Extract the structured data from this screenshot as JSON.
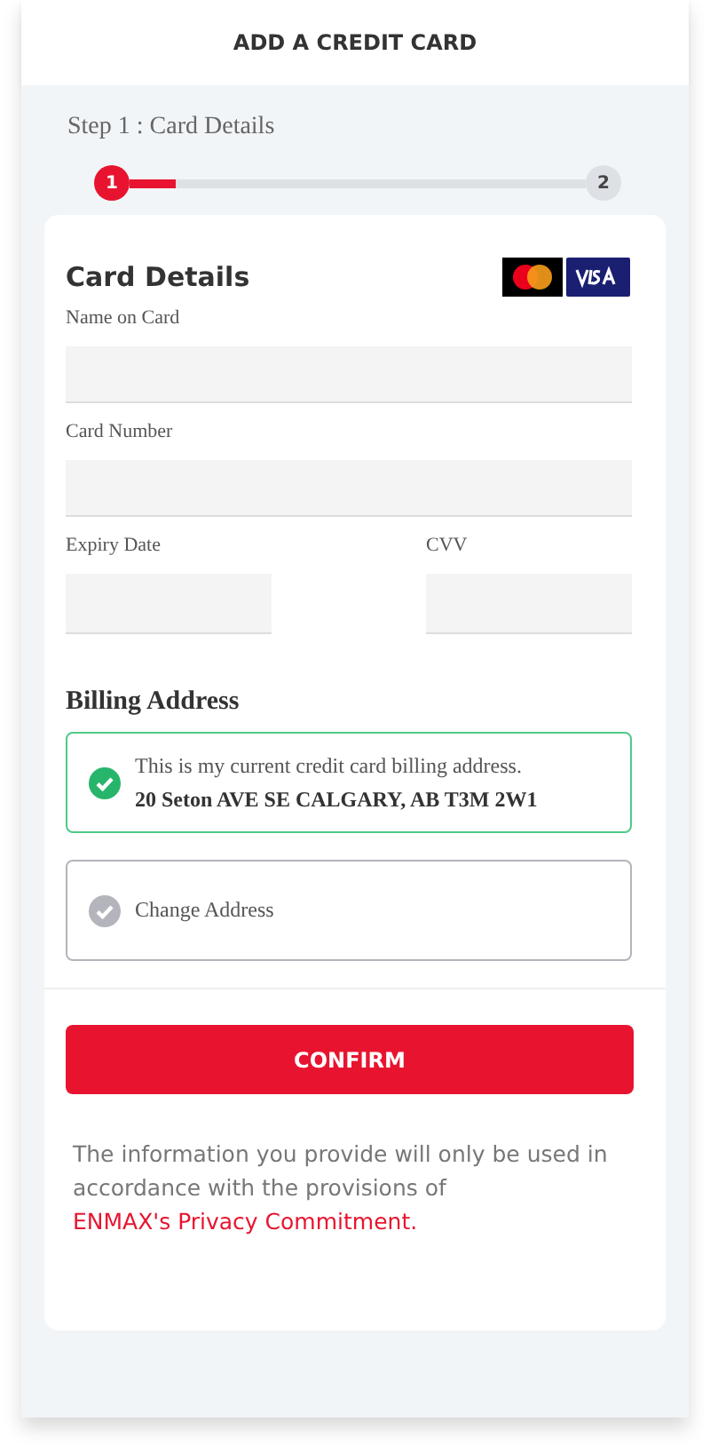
{
  "header": {
    "title": "ADD A CREDIT CARD"
  },
  "step": {
    "label": "Step 1 : Card Details",
    "level": 0.1,
    "steps": [
      {
        "number": "1",
        "selected": true
      },
      {
        "number": "2",
        "selected": false
      }
    ]
  },
  "card_details": {
    "title": "Card Details",
    "fields": [
      {
        "label": "Name on Card",
        "kind": "wide"
      },
      {
        "label": "Card Number",
        "kind": "wide"
      },
      {
        "label": "Expiry Date",
        "kind": "narrow"
      },
      {
        "label": "CVV",
        "kind": "narrow"
      }
    ]
  },
  "billing": {
    "title": "Billing Address",
    "options": [
      {
        "text": "This is my current credit card billing address.",
        "address": "20 Seton AVE SE CALGARY, AB T3M 2W1",
        "selected": true
      },
      {
        "text": "Change Address",
        "selected": false
      }
    ]
  },
  "confirm_button": "CONFIRM",
  "notice": {
    "text": "The information you provide will only be used in accordance with the provisions of",
    "link": "ENMAX's Privacy Commitment."
  }
}
